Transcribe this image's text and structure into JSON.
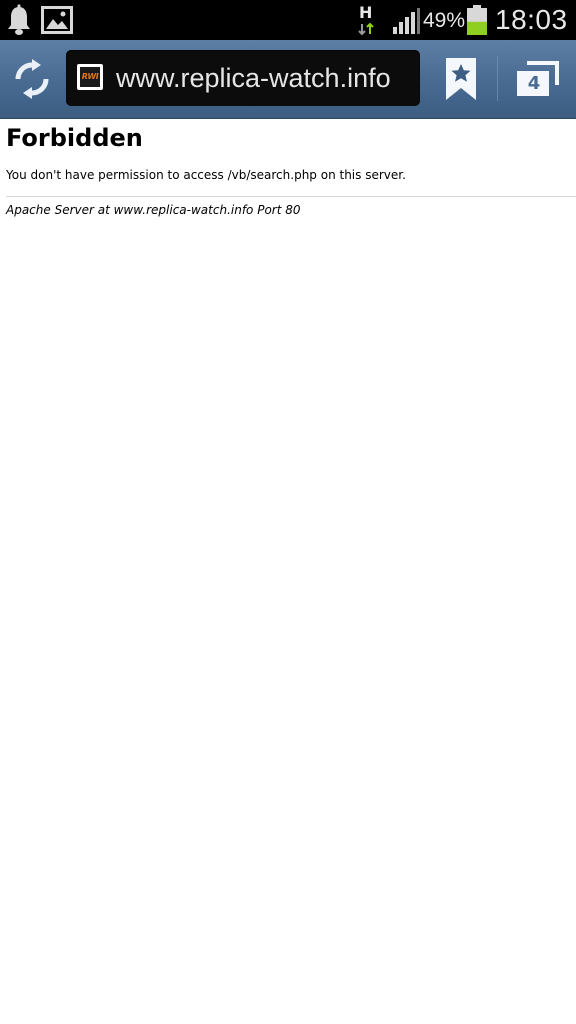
{
  "status_bar": {
    "network_type": "H",
    "battery_percent": "49%",
    "battery_level": 0.49,
    "time": "18:03",
    "icons": [
      "notification-bell-icon",
      "image-notification-icon",
      "network-h-icon",
      "signal-strength-icon",
      "battery-icon"
    ]
  },
  "toolbar": {
    "url": "www.replica-watch.info",
    "favicon_text": "RWI",
    "tab_count": "4",
    "icons": [
      "refresh-icon",
      "bookmark-star-icon",
      "tabs-icon"
    ]
  },
  "page": {
    "title": "Forbidden",
    "message": "You don't have permission to access /vb/search.php on this server.",
    "server_signature": "Apache Server at www.replica-watch.info Port 80"
  },
  "colors": {
    "toolbar": "#4a6c93",
    "battery_fill": "#8ecf1f",
    "favicon_accent": "#e2761a"
  }
}
